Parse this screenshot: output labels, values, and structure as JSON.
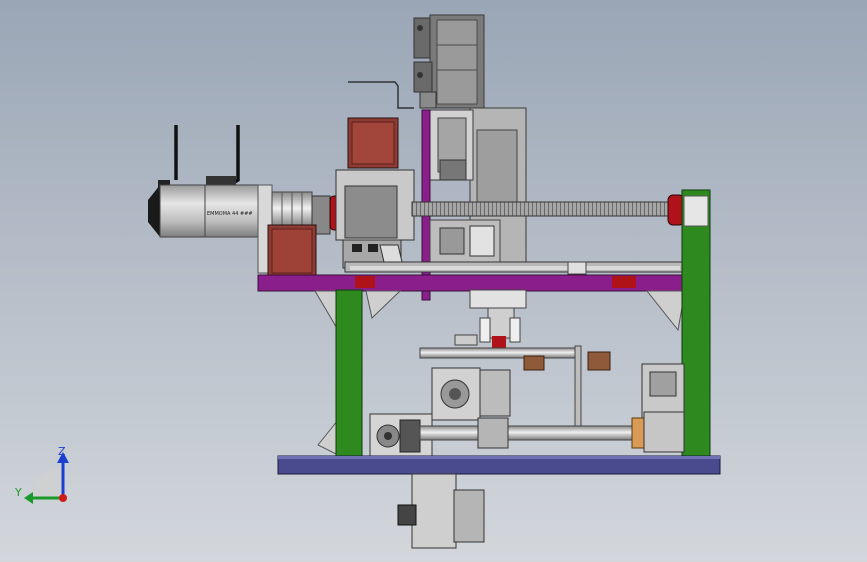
{
  "viewport": {
    "motor_label": "EMMOMA 44 ###",
    "triad": {
      "z_label": "Z",
      "y_label": "Y",
      "colors": {
        "z": "#1a3fd0",
        "y": "#1a9a2a",
        "x": "#d01a1a"
      }
    }
  },
  "colors": {
    "background_top": "#9aa6b6",
    "background_bottom": "#d3d7dc",
    "frame_green": "#2e8a1e",
    "frame_purple": "#8a1e8a",
    "base_plate_blue": "#4a4a8e",
    "motor_body": "#c8c8c8",
    "copper": "#8e3c33",
    "lead_screw": "#9a9a9a",
    "accent_red": "#b0121a"
  }
}
